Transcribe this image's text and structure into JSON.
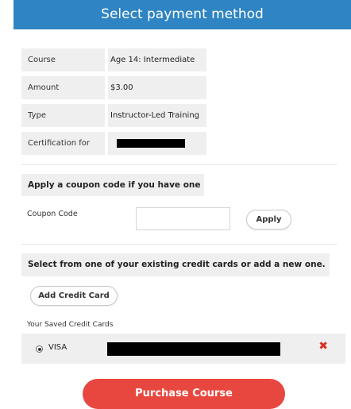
{
  "header": {
    "title": "Select payment method"
  },
  "details": [
    {
      "label": "Course",
      "value": "Age 14: Intermediate"
    },
    {
      "label": "Amount",
      "value": "$3.00"
    },
    {
      "label": "Type",
      "value": "Instructor-Led Training"
    },
    {
      "label": "Certification for",
      "value": ""
    }
  ],
  "coupon": {
    "title": "Apply a coupon code if you have one",
    "label": "Coupon Code",
    "value": "",
    "apply_label": "Apply"
  },
  "cards": {
    "title": "Select from one of your existing credit cards or add a new one.",
    "add_label": "Add Credit Card",
    "saved_label": "Your Saved Credit Cards",
    "items": [
      {
        "brand": "VISA",
        "selected": true
      }
    ]
  },
  "purchase_label": "Purchase Course",
  "colors": {
    "header": "#2f84c3",
    "purchase": "#e8473f",
    "delete": "#d93025"
  }
}
